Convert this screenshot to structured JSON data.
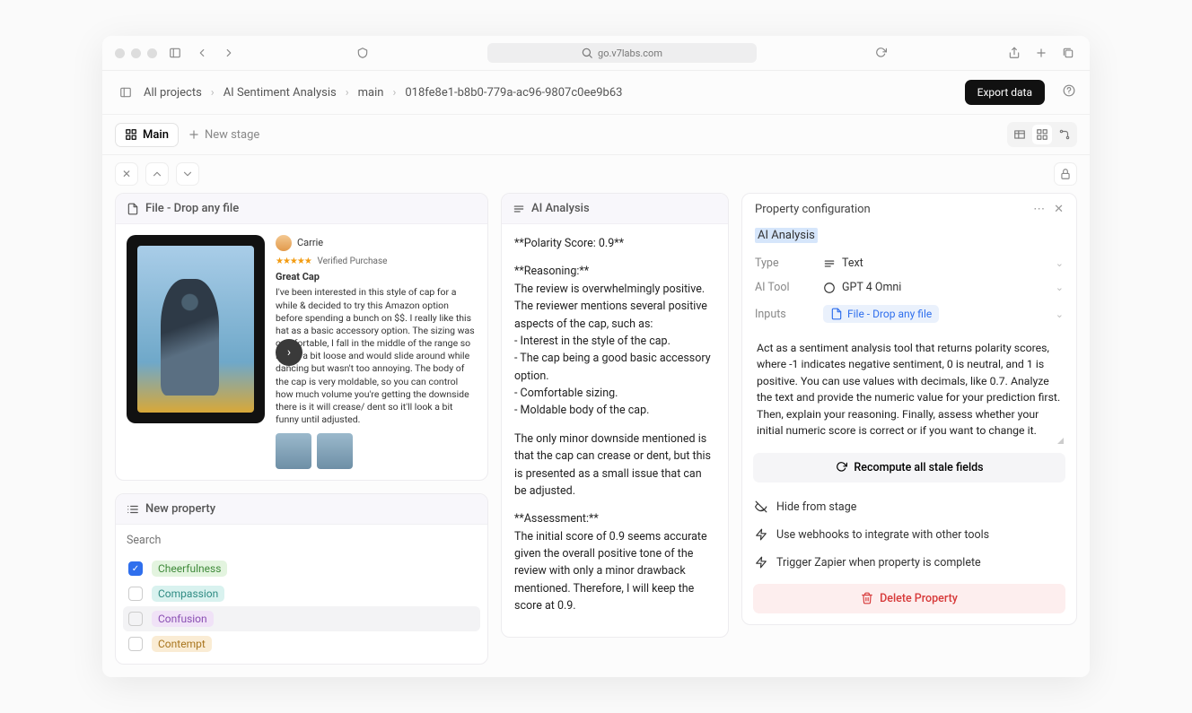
{
  "browser": {
    "url": "go.v7labs.com"
  },
  "breadcrumbs": {
    "items": [
      "All projects",
      "AI Sentiment Analysis",
      "main",
      "018fe8e1-b8b0-779a-ac96-9807c0ee9b63"
    ],
    "export_label": "Export data"
  },
  "stage": {
    "current": "Main",
    "new_label": "New stage"
  },
  "file_card": {
    "title": "File - Drop any file",
    "reviewer": "Carrie",
    "verified": "Verified Purchase",
    "review_title": "Great Cap",
    "review_body": "I've been interested in this style of cap for a while & decided to try this Amazon option before spending a bunch on $$. I really like this hat as a basic accessory option. The sizing was comfortable, I fall in the middle of the range so it was a bit loose and would slide around while dancing but wasn't too annoying. The body of the cap is very moldable, so you can control how much volume you're getting the downside there is it will crease/ dent so it'll look a bit funny until adjusted."
  },
  "new_property": {
    "title": "New property",
    "search_placeholder": "Search",
    "items": [
      {
        "label": "Cheerfulness",
        "bg": "#e3f4df",
        "fg": "#3f8a3a",
        "checked": true
      },
      {
        "label": "Compassion",
        "bg": "#d9f2ef",
        "fg": "#2f8b83",
        "checked": false
      },
      {
        "label": "Confusion",
        "bg": "#f0e2f7",
        "fg": "#8a4fb3",
        "checked": false
      },
      {
        "label": "Contempt",
        "bg": "#faecd4",
        "fg": "#a9761f",
        "checked": false
      }
    ]
  },
  "analysis": {
    "title": "AI Analysis",
    "score_line": "**Polarity Score: 0.9**",
    "reasoning_hd": "**Reasoning:**",
    "reasoning_intro": "The review is overwhelmingly positive. The reviewer mentions several positive aspects of the cap, such as:",
    "bullets": [
      "- Interest in the style of the cap.",
      "- The cap being a good basic accessory option.",
      "- Comfortable sizing.",
      "- Moldable body of the cap."
    ],
    "downside": "The only minor downside mentioned is that the cap can crease or dent, but this is presented as a small issue that can be adjusted.",
    "assessment_hd": "**Assessment:**",
    "assessment": "The initial score of 0.9 seems accurate given the overall positive tone of the review with only a minor drawback mentioned. Therefore, I will keep the score at 0.9."
  },
  "prop_config": {
    "header": "Property configuration",
    "name": "AI Analysis",
    "type_label": "Type",
    "type_value": "Text",
    "tool_label": "AI Tool",
    "tool_value": "GPT 4 Omni",
    "inputs_label": "Inputs",
    "inputs_value": "File - Drop any file",
    "prompt": "Act as a sentiment analysis tool that returns polarity scores, where -1 indicates negative sentiment, 0 is neutral, and 1 is positive. You can use values with decimals, like 0.7. Analyze the text and provide the numeric value for your prediction first. Then, explain your reasoning. Finally, assess whether your initial numeric score is correct or if you want to change it.",
    "recompute": "Recompute all stale fields",
    "actions": {
      "hide": "Hide from stage",
      "webhooks": "Use webhooks to integrate with other tools",
      "zapier": "Trigger Zapier when property is complete",
      "delete": "Delete Property"
    }
  }
}
